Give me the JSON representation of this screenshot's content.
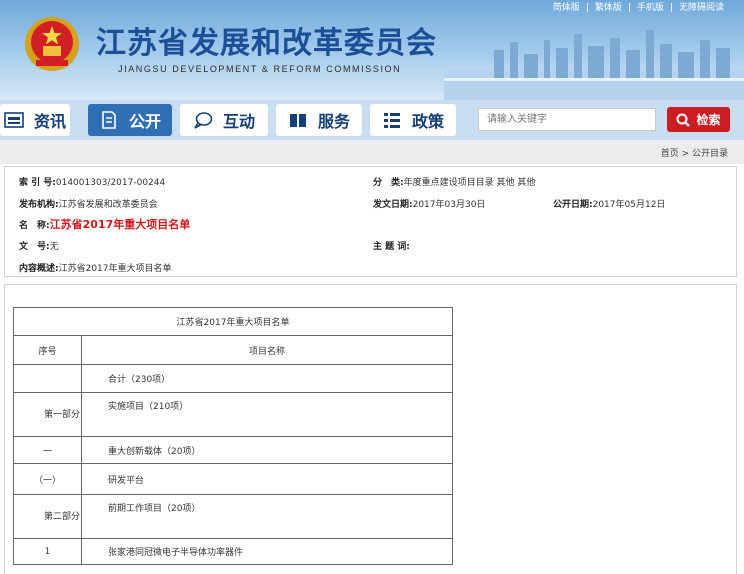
{
  "header": {
    "top_links": [
      "简体版",
      "繁体版",
      "手机版",
      "无障碍阅读"
    ],
    "title": "江苏省发展和改革委员会",
    "subtitle": "JIANGSU DEVELOPMENT & REFORM COMMISSION"
  },
  "nav": {
    "items": [
      {
        "label": "资讯",
        "icon": "news-icon"
      },
      {
        "label": "公开",
        "icon": "document-icon"
      },
      {
        "label": "互动",
        "icon": "chat-icon"
      },
      {
        "label": "服务",
        "icon": "book-icon"
      },
      {
        "label": "政策",
        "icon": "list-icon"
      }
    ],
    "active": "公开",
    "search_placeholder": "请输入关键字",
    "search_button": "检索"
  },
  "breadcrumb": "首页 > 公开目录",
  "info": {
    "index_label": "索 引 号:",
    "index_value": "014001303/2017-00244",
    "category_label": "分　类:",
    "category_value": "年度重点建设项目目录  其他 其他",
    "publisher_label": "发布机构:",
    "publisher_value": "江苏省发展和改革委员会",
    "issue_date_label": "发文日期:",
    "issue_date_value": "2017年03月30日",
    "public_date_label": "公开日期:",
    "public_date_value": "2017年05月12日",
    "name_label": "名　称:",
    "name_value": "江苏省2017年重大项目名单",
    "docno_label": "文　号:",
    "docno_value": "无",
    "keywords_label": "主 题 词:",
    "keywords_value": "",
    "summary_label": "内容概述:",
    "summary_value": "江苏省2017年重大项目名单"
  },
  "table": {
    "caption": "江苏省2017年重大项目名单",
    "headers": [
      "序号",
      "项目名称"
    ],
    "rows": [
      {
        "num": "",
        "name": "合计（230项）"
      },
      {
        "num": "第一部分",
        "name": "实施项目（210项）"
      },
      {
        "num": "一",
        "name": "重大创新载体（20项）"
      },
      {
        "num": "（一）",
        "name": "研发平台"
      },
      {
        "num": "第二部分",
        "name": "前期工作项目（20项）"
      },
      {
        "num": "1",
        "name": "张家港同冠微电子半导体功率器件"
      }
    ]
  },
  "colors": {
    "brand_blue": "#1d4f97",
    "nav_active": "#2f6fb3",
    "search_red": "#cc1d24",
    "title_red": "#d1171d"
  }
}
